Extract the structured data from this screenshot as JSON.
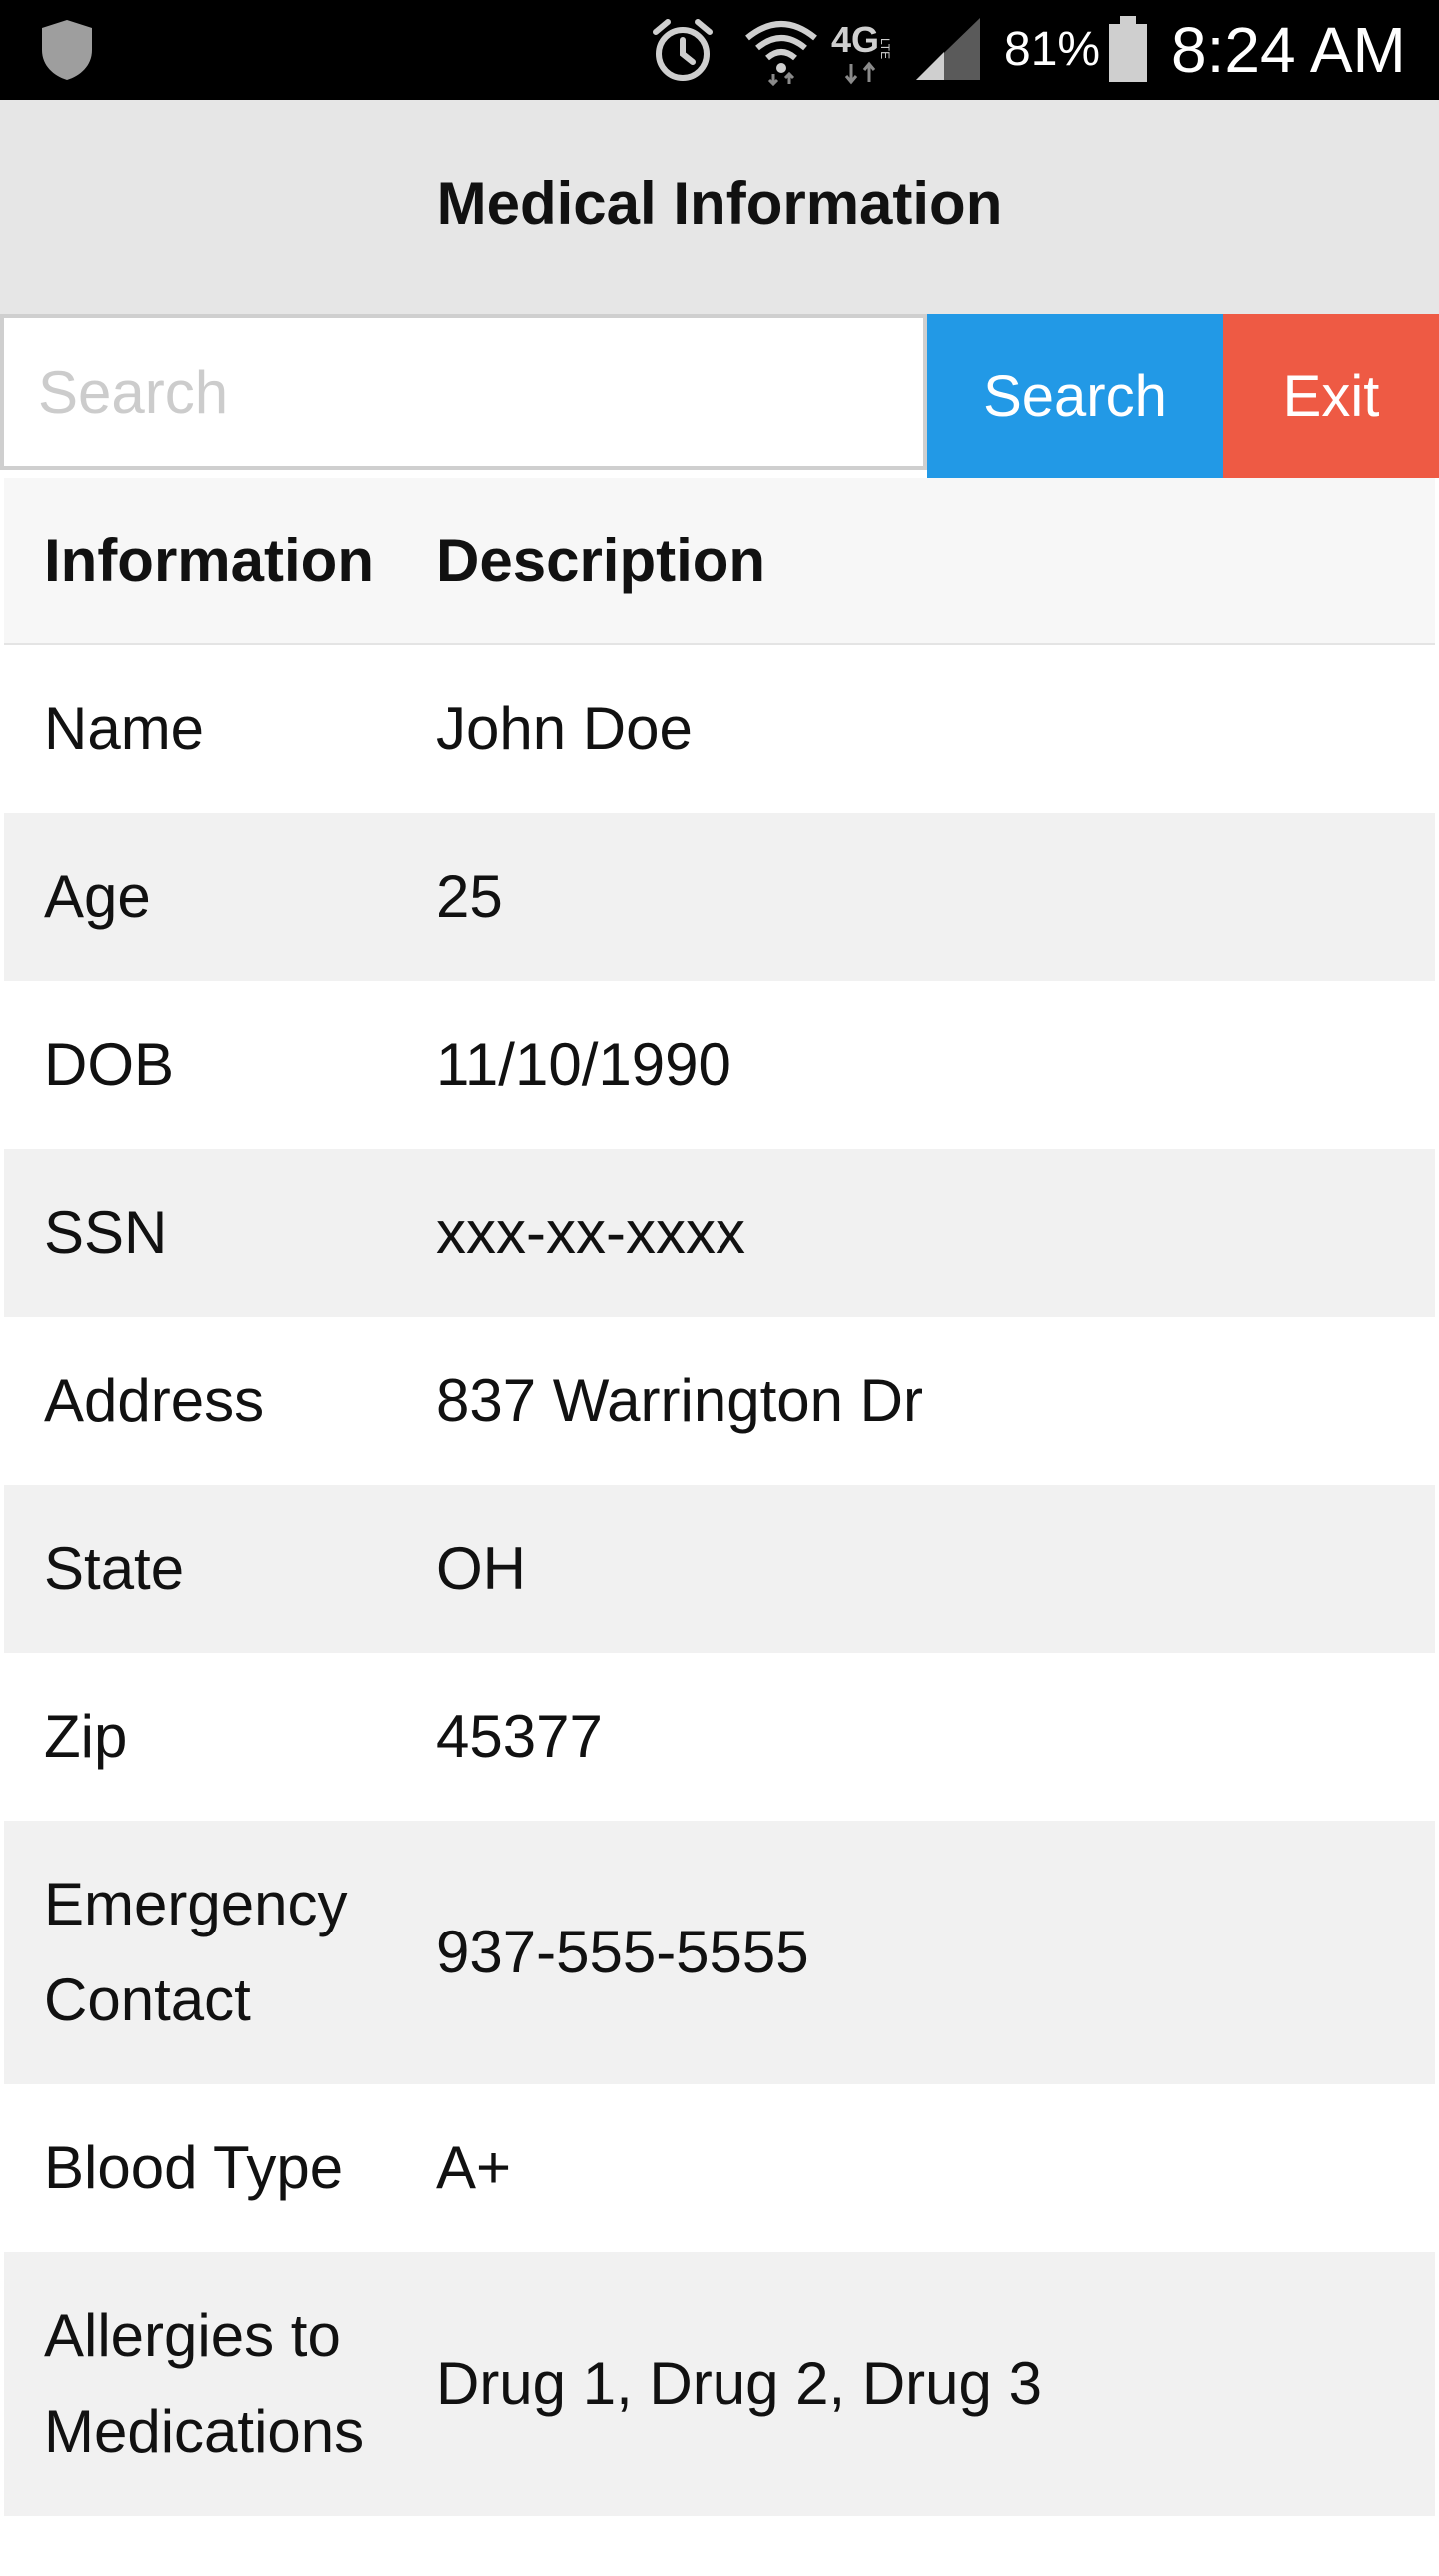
{
  "status_bar": {
    "battery_percent": "81%",
    "time": "8:24 AM",
    "network": "4G LTE",
    "icons": [
      "shield-icon",
      "alarm-icon",
      "wifi-icon",
      "lte-icon",
      "signal-icon",
      "battery-icon"
    ]
  },
  "header": {
    "title": "Medical Information"
  },
  "search": {
    "placeholder": "Search",
    "value": "",
    "search_label": "Search",
    "exit_label": "Exit"
  },
  "colors": {
    "search_button": "#2299e6",
    "exit_button": "#ee5a44",
    "header_bg": "#e6e6e6"
  },
  "table": {
    "columns": [
      "Information",
      "Description"
    ],
    "rows": [
      {
        "info": "Name",
        "desc": "John Doe"
      },
      {
        "info": "Age",
        "desc": "25"
      },
      {
        "info": "DOB",
        "desc": "11/10/1990"
      },
      {
        "info": "SSN",
        "desc": "xxx-xx-xxxx"
      },
      {
        "info": "Address",
        "desc": "837 Warrington Dr"
      },
      {
        "info": "State",
        "desc": "OH"
      },
      {
        "info": "Zip",
        "desc": "45377"
      },
      {
        "info": "Emergency Contact",
        "desc": "937-555-5555"
      },
      {
        "info": "Blood Type",
        "desc": "A+"
      },
      {
        "info": "Allergies to Medications",
        "desc": "Drug 1, Drug 2, Drug 3"
      }
    ]
  }
}
